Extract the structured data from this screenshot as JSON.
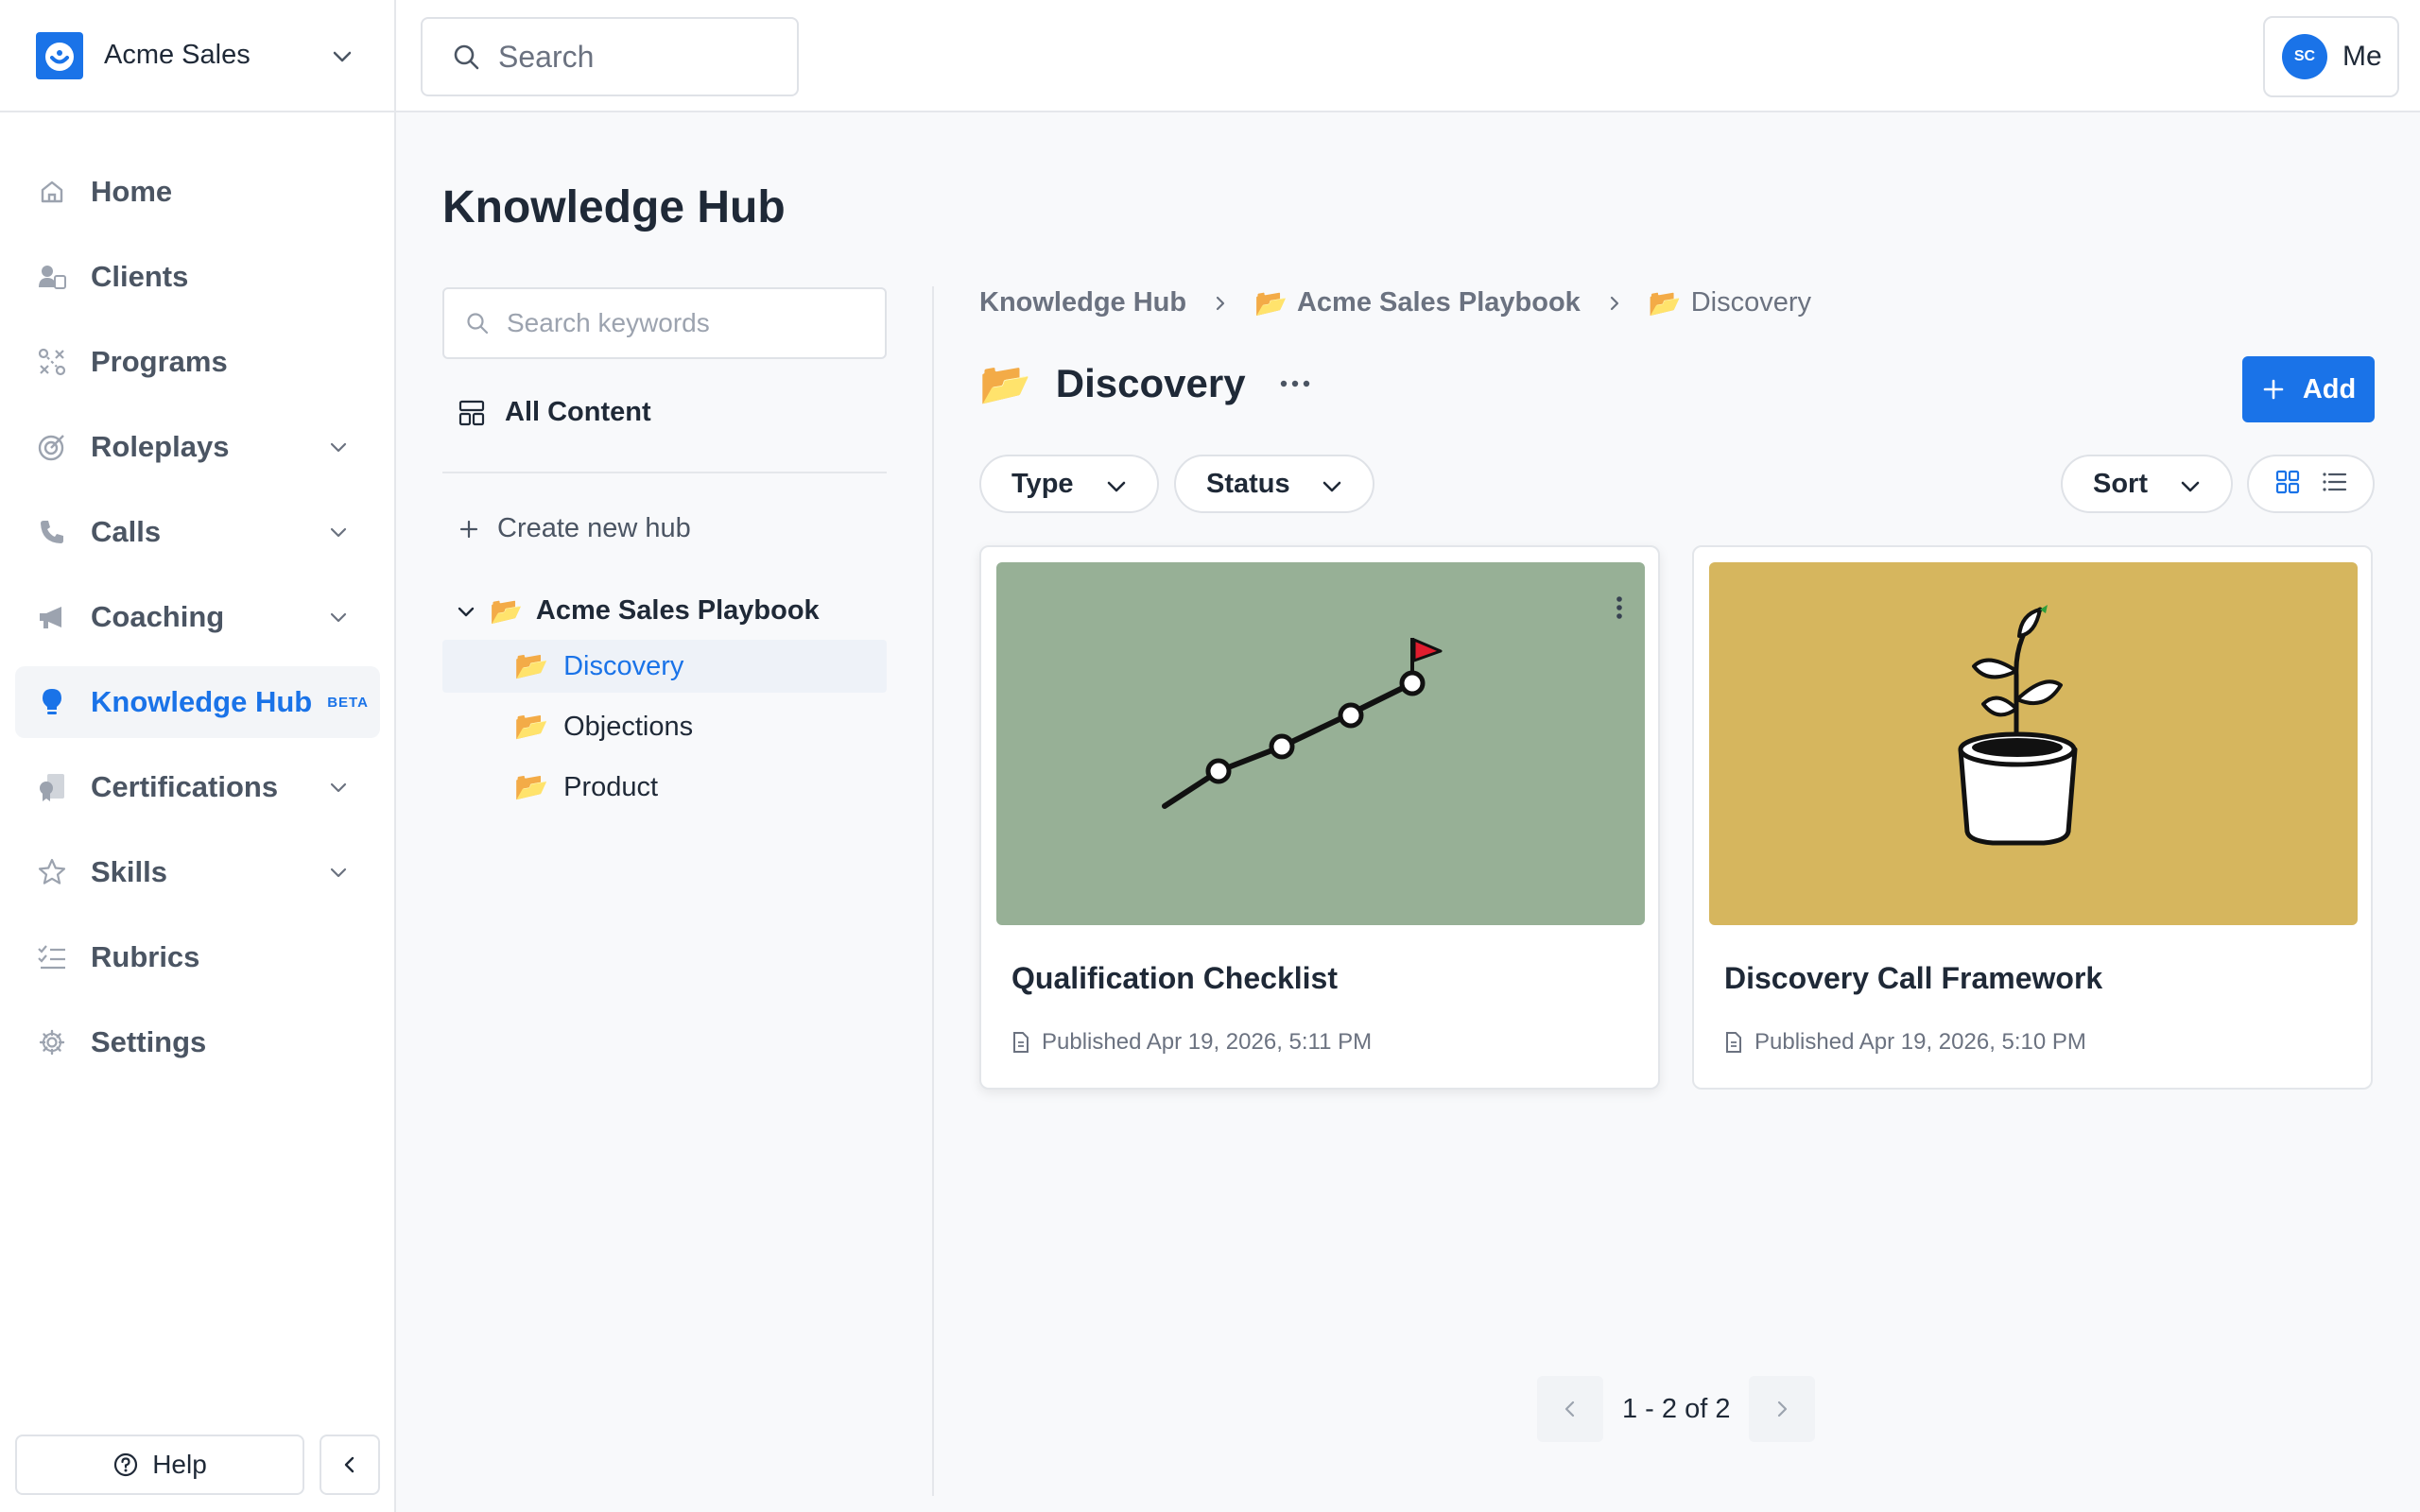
{
  "brand": {
    "name": "Acme Sales",
    "logo_color": "#1a73e8"
  },
  "sidebar": {
    "items": [
      {
        "label": "Home",
        "icon": "home-icon",
        "expandable": false
      },
      {
        "label": "Clients",
        "icon": "clients-icon",
        "expandable": false
      },
      {
        "label": "Programs",
        "icon": "programs-icon",
        "expandable": false
      },
      {
        "label": "Roleplays",
        "icon": "target-icon",
        "expandable": true
      },
      {
        "label": "Calls",
        "icon": "phone-icon",
        "expandable": true
      },
      {
        "label": "Coaching",
        "icon": "megaphone-icon",
        "expandable": true
      },
      {
        "label": "Knowledge Hub",
        "icon": "lightbulb-icon",
        "expandable": false,
        "active": true,
        "badge": "BETA"
      },
      {
        "label": "Certifications",
        "icon": "certificate-icon",
        "expandable": true
      },
      {
        "label": "Skills",
        "icon": "star-icon",
        "expandable": true
      },
      {
        "label": "Rubrics",
        "icon": "checklist-icon",
        "expandable": false
      },
      {
        "label": "Settings",
        "icon": "gear-icon",
        "expandable": false
      }
    ],
    "help_label": "Help"
  },
  "topbar": {
    "search_placeholder": "Search",
    "user_initials": "SC",
    "user_label": "Me"
  },
  "page": {
    "title": "Knowledge Hub"
  },
  "hub_panel": {
    "search_placeholder": "Search keywords",
    "all_content_label": "All Content",
    "create_hub_label": "Create new hub",
    "tree": {
      "root": "Acme Sales Playbook",
      "children": [
        "Discovery",
        "Objections",
        "Product"
      ],
      "selected": "Discovery"
    }
  },
  "main": {
    "breadcrumb": [
      "Knowledge Hub",
      "Acme Sales Playbook",
      "Discovery"
    ],
    "folder_title": "Discovery",
    "add_label": "Add",
    "filters": {
      "type_label": "Type",
      "status_label": "Status",
      "sort_label": "Sort"
    },
    "view_mode": "grid",
    "cards": [
      {
        "title": "Qualification Checklist",
        "published": "Published Apr 19, 2026, 5:11 PM",
        "thumb_color": "#97b096",
        "illustration": "progress-chart-flag"
      },
      {
        "title": "Discovery Call Framework",
        "published": "Published Apr 19, 2026, 5:10 PM",
        "thumb_color": "#d6b65e",
        "illustration": "plant-pot"
      }
    ],
    "pagination": "1 - 2 of 2"
  },
  "colors": {
    "accent": "#1a73e8",
    "text": "#1f2937",
    "muted": "#6b7280",
    "border": "#e5e7eb"
  }
}
